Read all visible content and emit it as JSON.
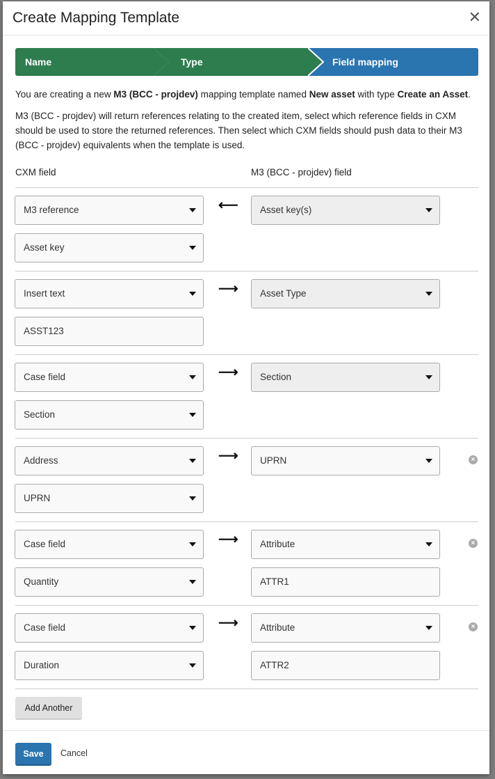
{
  "modal": {
    "title": "Create Mapping Template",
    "close_icon": "close-icon"
  },
  "steps": [
    {
      "label": "Name",
      "color": "#2e7d4f",
      "state": "done"
    },
    {
      "label": "Type",
      "color": "#2e7d4f",
      "state": "done"
    },
    {
      "label": "Field mapping",
      "color": "#2a74b0",
      "state": "active"
    }
  ],
  "intro": {
    "p1_a": "You are creating a new ",
    "p1_b": "M3 (BCC - projdev)",
    "p1_c": " mapping template named ",
    "p1_d": "New asset",
    "p1_e": " with type ",
    "p1_f": "Create an Asset",
    "p1_g": ".",
    "p2": "M3 (BCC - projdev) will return references relating to the created item, select which reference fields in CXM should be used to store the returned references. Then select which CXM fields should push data to their M3 (BCC - projdev) equivalents when the template is used."
  },
  "columns": {
    "left": "CXM field",
    "right": "M3 (BCC - projdev) field"
  },
  "rows": [
    {
      "left1": "M3 reference",
      "left1_type": "select",
      "left2": "Asset key",
      "left2_type": "select",
      "direction": "left",
      "right1": "Asset key(s)",
      "right1_type": "select-readonly",
      "removable": false
    },
    {
      "left1": "Insert text",
      "left1_type": "select",
      "left2": "ASST123",
      "left2_type": "input",
      "direction": "right",
      "right1": "Asset Type",
      "right1_type": "select-readonly",
      "removable": false
    },
    {
      "left1": "Case field",
      "left1_type": "select",
      "left2": "Section",
      "left2_type": "select",
      "direction": "right",
      "right1": "Section",
      "right1_type": "select-readonly",
      "removable": false
    },
    {
      "left1": "Address",
      "left1_type": "select",
      "left2": "UPRN",
      "left2_type": "select",
      "direction": "right",
      "right1": "UPRN",
      "right1_type": "select",
      "removable": true
    },
    {
      "left1": "Case field",
      "left1_type": "select",
      "left2": "Quantity",
      "left2_type": "select",
      "direction": "right",
      "right1": "Attribute",
      "right1_type": "select",
      "right2": "ATTR1",
      "right2_type": "input",
      "removable": true
    },
    {
      "left1": "Case field",
      "left1_type": "select",
      "left2": "Duration",
      "left2_type": "select",
      "direction": "right",
      "right1": "Attribute",
      "right1_type": "select",
      "right2": "ATTR2",
      "right2_type": "input",
      "removable": true
    }
  ],
  "arrows": {
    "left": "⟵",
    "right": "⟶"
  },
  "actions": {
    "add_another": "Add Another",
    "save": "Save",
    "cancel": "Cancel"
  }
}
